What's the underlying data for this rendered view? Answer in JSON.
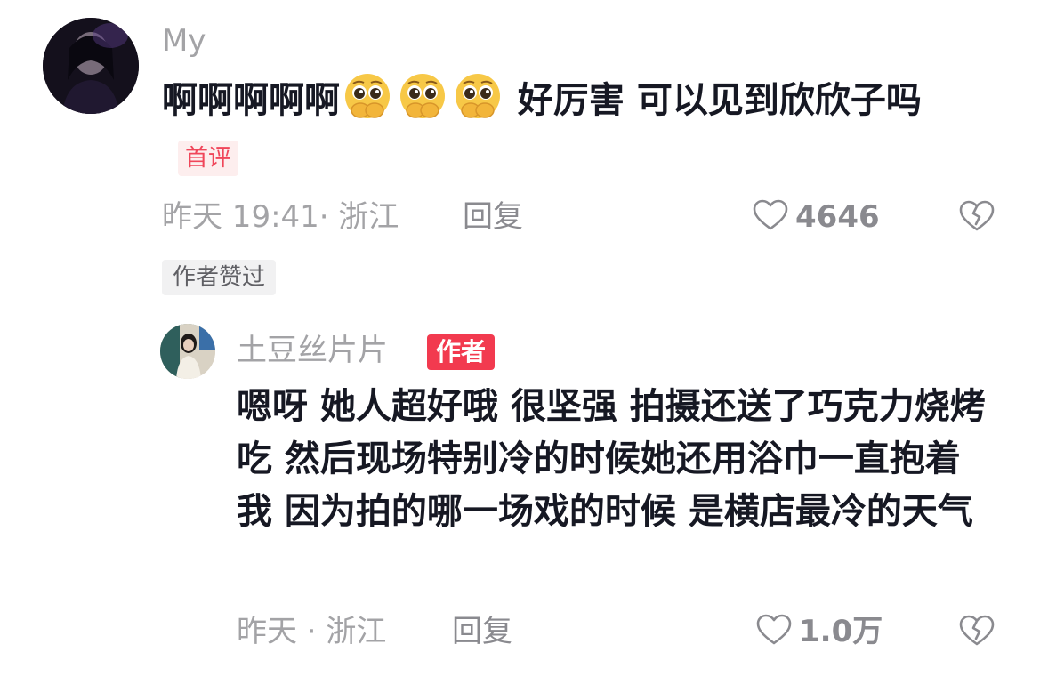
{
  "comment": {
    "username": "My",
    "text_part1": "啊啊啊啊啊",
    "emojis": [
      "pleading-face-emoji",
      "pleading-face-emoji",
      "pleading-face-emoji"
    ],
    "text_part2": " 好厉害 可以见到欣欣子吗",
    "first_comment_tag": "首评",
    "time_location": "昨天 19:41· 浙江",
    "reply_label": "回复",
    "like_count": "4646",
    "author_liked_tag": "作者赞过"
  },
  "reply": {
    "username": "土豆丝片片",
    "author_tag": "作者",
    "text": "嗯呀 她人超好哦 很坚强 拍摄还送了巧克力烧烤吃 然后现场特别冷的时候她还用浴巾一直抱着我 因为拍的哪一场戏的时候 是横店最冷的天气",
    "time_location": "昨天 · 浙江",
    "reply_label": "回复",
    "like_count": "1.0万"
  },
  "colors": {
    "primary_text": "#161823",
    "secondary_text": "#a3a3a6",
    "first_tag_bg": "#fdeeee",
    "first_tag_text": "#f0465a",
    "author_tag_bg": "#f23a4f"
  }
}
